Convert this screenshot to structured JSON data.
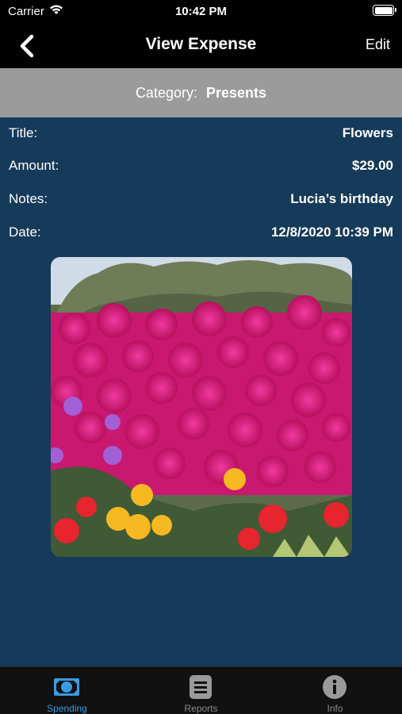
{
  "status_bar": {
    "carrier": "Carrier",
    "time": "10:42 PM"
  },
  "nav": {
    "title": "View Expense",
    "edit_label": "Edit"
  },
  "category": {
    "label": "Category:",
    "value": "Presents"
  },
  "details": [
    {
      "label": "Title:",
      "value": "Flowers"
    },
    {
      "label": "Amount:",
      "value": "$29.00"
    },
    {
      "label": "Notes:",
      "value": "Lucia’s birthday"
    },
    {
      "label": "Date:",
      "value": "12/8/2020 10:39 PM"
    }
  ],
  "tabs": [
    {
      "label": "Spending",
      "icon": "spending-icon",
      "active": true
    },
    {
      "label": "Reports",
      "icon": "reports-icon",
      "active": false
    },
    {
      "label": "Info",
      "icon": "info-icon",
      "active": false
    }
  ],
  "colors": {
    "content_bg": "#163a59",
    "category_bg": "#9b9b9b",
    "active_tab": "#3a9be3",
    "inactive_tab": "#8a8a8a"
  }
}
